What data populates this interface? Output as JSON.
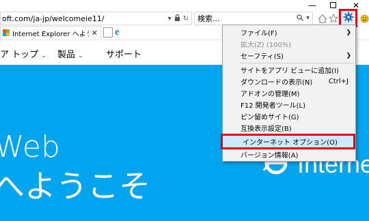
{
  "address_bar": {
    "url": "oft.com/ja-jp/welcomeie11/"
  },
  "search": {
    "placeholder": "検索..."
  },
  "tab": {
    "title": "Internet Explorer へようこそ"
  },
  "site_nav": {
    "items": [
      "ア トップ",
      "製品",
      "サポート"
    ]
  },
  "hero": {
    "line1": "Web",
    "line2": "へようこそ",
    "brand": "Internet"
  },
  "tools_menu": {
    "items": [
      {
        "label": "ファイル(F)",
        "shortcut": "",
        "submenu": true,
        "enabled": true
      },
      {
        "label": "拡大(Z) (100%)",
        "shortcut": "",
        "submenu": false,
        "enabled": false
      },
      {
        "label": "セーフティ(S)",
        "shortcut": "",
        "submenu": true,
        "enabled": true
      },
      {
        "label": "サイトをアプリ ビューに追加(I)",
        "shortcut": "",
        "submenu": false,
        "enabled": true
      },
      {
        "label": "ダウンロードの表示(N)",
        "shortcut": "Ctrl+J",
        "submenu": false,
        "enabled": true
      },
      {
        "label": "アドオンの管理(M)",
        "shortcut": "",
        "submenu": false,
        "enabled": true
      },
      {
        "label": "F12 開発者ツール(L)",
        "shortcut": "",
        "submenu": false,
        "enabled": true
      },
      {
        "label": "ピン留めサイト(G)",
        "shortcut": "",
        "submenu": false,
        "enabled": true
      },
      {
        "label": "互換表示設定(B)",
        "shortcut": "",
        "submenu": false,
        "enabled": true
      },
      {
        "label": "インターネット オプション(O)",
        "shortcut": "",
        "submenu": false,
        "enabled": true,
        "highlighted": true
      },
      {
        "label": "バージョン情報(A)",
        "shortcut": "",
        "submenu": false,
        "enabled": true
      }
    ]
  },
  "colors": {
    "highlight_border": "#e60012",
    "hero_bg": "#00a4ef",
    "menu_bg": "#f2f2f2",
    "highlight_bg": "#cde8ff"
  }
}
